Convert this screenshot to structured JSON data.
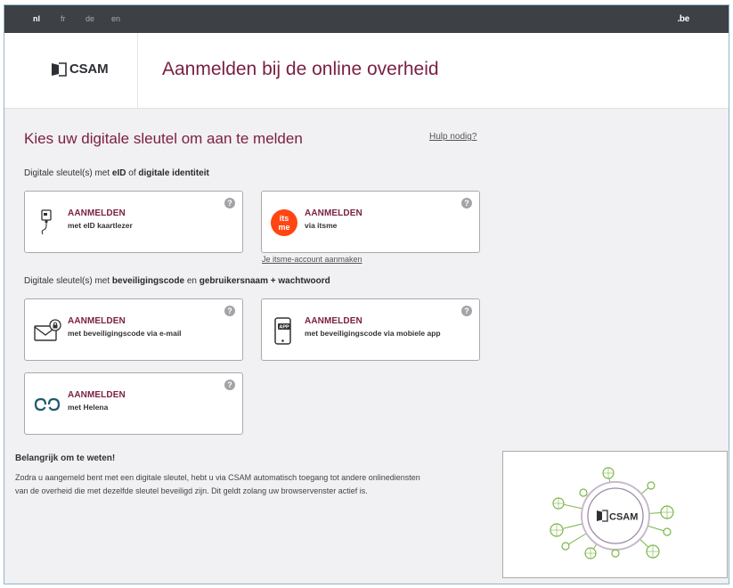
{
  "topbar": {
    "languages": [
      "nl",
      "fr",
      "de",
      "en"
    ],
    "active_language": "nl",
    "domain_logo": ".be"
  },
  "header": {
    "logo_text": "CSAM",
    "title": "Aanmelden bij de online overheid"
  },
  "main": {
    "title": "Kies uw digitale sleutel om aan te melden",
    "help_link": "Hulp nodig?",
    "section1": {
      "prefix": "Digitale sleutel(s) met ",
      "bold1": "eID",
      "middle": " of ",
      "bold2": "digitale identiteit"
    },
    "section2": {
      "prefix": "Digitale sleutel(s) met ",
      "bold1": "beveiligingscode",
      "middle": " en ",
      "bold2": "gebruikersnaam + wachtwoord"
    },
    "cards": [
      {
        "title": "AANMELDEN",
        "subtitle": "met eID kaartlezer",
        "icon": "card-reader-icon"
      },
      {
        "title": "AANMELDEN",
        "subtitle": "via itsme",
        "icon": "itsme-logo",
        "logo_text": "its me"
      },
      {
        "title": "AANMELDEN",
        "subtitle": "met beveiligingscode via e-mail",
        "icon": "email-lock-icon"
      },
      {
        "title": "AANMELDEN",
        "subtitle": "met beveiligingscode via mobiele app",
        "icon": "mobile-app-icon",
        "icon_text": "APP"
      },
      {
        "title": "AANMELDEN",
        "subtitle": "met Helena",
        "icon": "helena-icon"
      }
    ],
    "help_icon_glyph": "?",
    "itsme_account_link": "Je itsme-account aanmaken"
  },
  "info": {
    "title": "Belangrijk om te weten!",
    "text": "Zodra u aangemeld bent met een digitale sleutel, hebt u via CSAM automatisch toegang tot andere onlinediensten van de overheid die met dezelfde sleutel beveiligd zijn. Dit geldt zolang uw browservenster actief is.",
    "image_logo_text": "CSAM"
  },
  "colors": {
    "brand": "#7b2044",
    "topbar": "#3d4044",
    "itsme": "#ff4612",
    "network_green": "#7ab648"
  }
}
